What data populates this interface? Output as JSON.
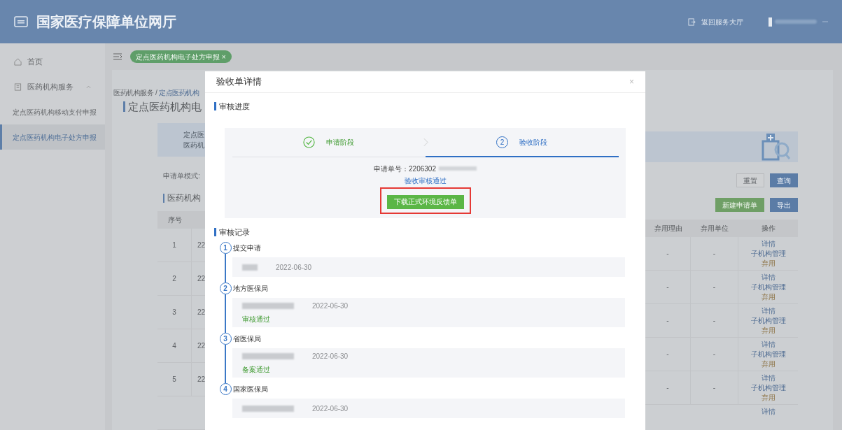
{
  "header": {
    "title": "国家医疗保障单位网厅",
    "return_link": "返回服务大厅"
  },
  "sidebar": {
    "items": [
      {
        "label": "首页",
        "kind": "home",
        "selected": false
      },
      {
        "label": "医药机构服务",
        "kind": "group",
        "expanded": true,
        "children": [
          {
            "label": "定点医药机构移动支付申报",
            "selected": false
          },
          {
            "label": "定点医药机构电子处方申报",
            "selected": true
          }
        ]
      }
    ]
  },
  "tabs": [
    {
      "label": "定点医药机构电子处方申报",
      "close": "×",
      "selected": true
    }
  ],
  "background": {
    "breadcrumb": [
      "医药机构服务",
      "/",
      "定点医药机构"
    ],
    "page_title": "定点医药机构电",
    "banner_lines": [
      "定点医",
      "医药机"
    ],
    "filter_label": "申请单模式:",
    "filter_buttons": [
      {
        "label": "重置",
        "kind": "plain"
      },
      {
        "label": "查询",
        "kind": "primary"
      }
    ],
    "section_title": "医药机构",
    "action_buttons": [
      {
        "label": "新建申请单",
        "kind": "success"
      },
      {
        "label": "导出",
        "kind": "primary"
      }
    ],
    "table": {
      "left_columns": [
        "序号"
      ],
      "right_columns": [
        "弃用理由",
        "弃用单位",
        "操作"
      ],
      "rows": [
        {
          "index": "1",
          "column_2": "22",
          "reason": "-",
          "unit": "-",
          "actions": [
            "详情",
            "子机构管理",
            "弃用"
          ]
        },
        {
          "index": "2",
          "column_2": "22",
          "reason": "-",
          "unit": "-",
          "actions": [
            "详情",
            "子机构管理",
            "弃用"
          ]
        },
        {
          "index": "3",
          "column_2": "22",
          "reason": "-",
          "unit": "-",
          "actions": [
            "详情",
            "子机构管理",
            "弃用"
          ]
        },
        {
          "index": "4",
          "column_2": "22",
          "reason": "-",
          "unit": "-",
          "actions": [
            "详情",
            "子机构管理",
            "弃用"
          ]
        },
        {
          "index": "5",
          "column_2": "22",
          "reason": "-",
          "unit": "-",
          "actions": [
            "详情",
            "子机构管理",
            "弃用"
          ]
        },
        {
          "actions": [
            "详情"
          ]
        }
      ]
    }
  },
  "modal": {
    "title": "验收单详情",
    "close": "×",
    "progress_title": "审核进度",
    "steps": [
      {
        "label": "申请阶段",
        "completed": true,
        "selected": false
      },
      {
        "number": "2",
        "label": "验收阶段",
        "completed": false,
        "selected": true
      }
    ],
    "application_no": "申请单号：2206302",
    "result": "验收审核通过",
    "download_button": "下载正式环境反馈单",
    "download_highlighted": true,
    "records_title": "审核记录",
    "records": [
      {
        "number": "1",
        "label": "提交申请",
        "date": "2022-06-30"
      },
      {
        "number": "2",
        "label": "地方医保局",
        "date": "2022-06-30",
        "status": "审核通过"
      },
      {
        "number": "3",
        "label": "省医保局",
        "date": "2022-06-30",
        "status": "备案通过"
      },
      {
        "number": "4",
        "label": "国家医保局",
        "date": "2022-06-30"
      }
    ]
  }
}
